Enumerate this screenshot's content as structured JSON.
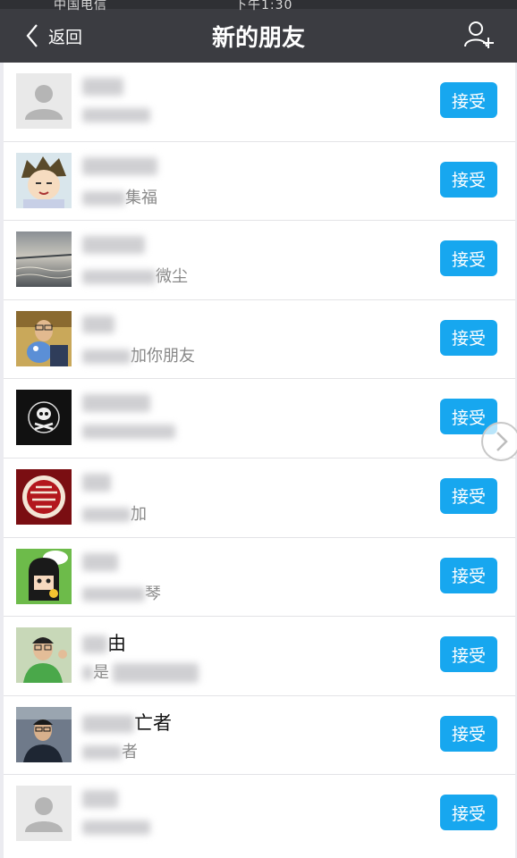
{
  "status_bar": {
    "carrier": "中国电信",
    "time": "下午1:30"
  },
  "header": {
    "back_label": "返回",
    "title": "新的朋友",
    "add_icon": "add-friend-icon"
  },
  "colors": {
    "header_bg": "#3b3c41",
    "accent": "#17a7ef",
    "list_bg": "#ffffff"
  },
  "requests": [
    {
      "avatar": "default-avatar",
      "name_visible": "",
      "message_visible": "",
      "accept_label": "接受"
    },
    {
      "avatar": "cartoon-boy-avatar",
      "name_visible": "",
      "message_visible": "集福",
      "accept_label": "接受"
    },
    {
      "avatar": "sea-sunset-avatar",
      "name_visible": "",
      "message_visible": "微尘",
      "accept_label": "接受"
    },
    {
      "avatar": "photo-man-avatar",
      "name_visible": "",
      "message_visible": "加你朋友",
      "accept_label": "接受"
    },
    {
      "avatar": "skull-logo-avatar",
      "name_visible": "",
      "message_visible": "",
      "accept_label": "接受"
    },
    {
      "avatar": "red-stamp-avatar",
      "name_visible": "",
      "message_visible": "加",
      "accept_label": "接受"
    },
    {
      "avatar": "cartoon-girl-avatar",
      "name_visible": "",
      "message_visible": "琴",
      "accept_label": "接受"
    },
    {
      "avatar": "photo-young-man-avatar",
      "name_visible": "由",
      "message_visible": "是",
      "accept_label": "接受"
    },
    {
      "avatar": "photo-man-glasses-avatar",
      "name_visible": "亡者",
      "message_visible": "者",
      "accept_label": "接受"
    },
    {
      "avatar": "default-avatar",
      "name_visible": "",
      "message_visible": "",
      "accept_label": "接受"
    }
  ]
}
